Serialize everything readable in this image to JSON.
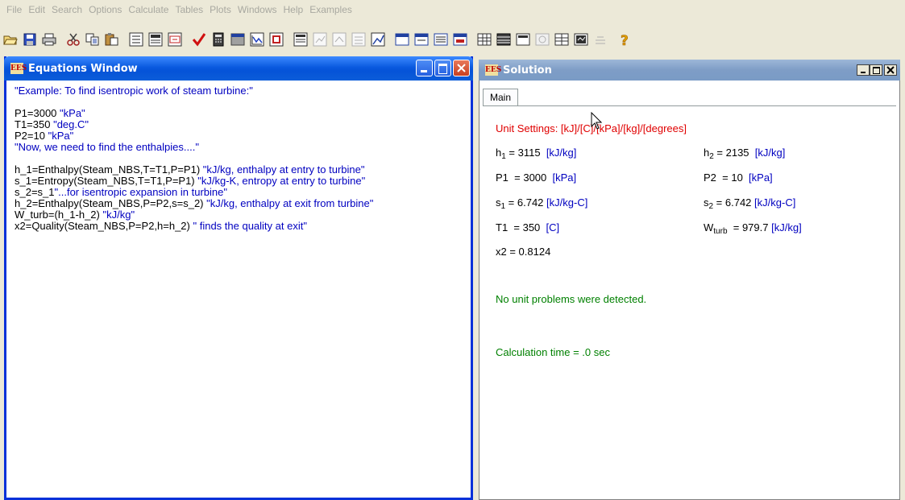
{
  "menu": [
    "File",
    "Edit",
    "Search",
    "Options",
    "Calculate",
    "Tables",
    "Plots",
    "Windows",
    "Help",
    "Examples"
  ],
  "equations_window": {
    "title": "Equations Window",
    "lines": [
      {
        "code": "",
        "comment": "\"Example: To find isentropic work of steam turbine:\""
      },
      {
        "gap": true
      },
      {
        "code": "P1=3000 ",
        "comment": "\"kPa\""
      },
      {
        "code": "T1=350 ",
        "comment": "\"deg.C\""
      },
      {
        "code": "P2=10 ",
        "comment": "\"kPa\""
      },
      {
        "code": "",
        "comment": "\"Now, we need to find the enthalpies....\""
      },
      {
        "gap": true
      },
      {
        "code": "h_1=Enthalpy(Steam_NBS,T=T1,P=P1) ",
        "comment": "\"kJ/kg, enthalpy at entry to turbine\""
      },
      {
        "code": "s_1=Entropy(Steam_NBS,T=T1,P=P1) ",
        "comment": "\"kJ/kg-K, entropy at entry to turbine\""
      },
      {
        "code": "s_2=s_1",
        "comment": "\"...for isentropic expansion in turbine\""
      },
      {
        "code": "h_2=Enthalpy(Steam_NBS,P=P2,s=s_2) ",
        "comment": "\"kJ/kg, enthalpy at exit from turbine\""
      },
      {
        "code": "W_turb=(h_1-h_2) ",
        "comment": "\"kJ/kg\""
      },
      {
        "code": "x2=Quality(Steam_NBS,P=P2,h=h_2) ",
        "comment": "\" finds the quality at exit\""
      }
    ]
  },
  "solution_window": {
    "title": "Solution",
    "tab": "Main",
    "unit_settings": "Unit Settings: [kJ]/[C]/[kPa]/[kg]/[degrees]",
    "results": {
      "h1": {
        "name": "h",
        "sub": "1",
        "value": " = 3115",
        "unit": "[kJ/kg]"
      },
      "h2": {
        "name": "h",
        "sub": "2",
        "value": " = 2135",
        "unit": "[kJ/kg]"
      },
      "P1": {
        "name": "P1",
        "value": "  = 3000",
        "unit": "[kPa]"
      },
      "P2": {
        "name": "P2",
        "value": "  = 10",
        "unit": "[kPa]"
      },
      "s1": {
        "name": "s",
        "sub": "1",
        "value": " = 6.742",
        "unit": "[kJ/kg-C]"
      },
      "s2": {
        "name": "s",
        "sub": "2",
        "value": " = 6.742",
        "unit": "[kJ/kg-C]"
      },
      "T1": {
        "name": "T1",
        "value": "  = 350",
        "unit": "[C]"
      },
      "Wturb": {
        "name": "W",
        "sub": "turb",
        "value": "  = 979.7",
        "unit": "[kJ/kg]"
      },
      "x2": {
        "name": "x2",
        "value": " = 0.8124"
      }
    },
    "unit_check": "No unit problems were detected.",
    "calc_time": "Calculation time = .0 sec"
  },
  "colors": {
    "comment": "#0000c0",
    "unit_settings": "#e00000",
    "status": "#008000",
    "active_title": "#0a5adf",
    "inactive_title": "#7e9dc6"
  },
  "toolbar_icons": [
    "open-icon",
    "save-icon",
    "print-icon",
    "cut-icon",
    "copy-icon",
    "paste-icon",
    "format-icon",
    "variable-info-icon",
    "unit-system-icon",
    "check-icon",
    "calculator-icon",
    "table-icon",
    "plot-icon",
    "solve-icon",
    "parametric-table-icon",
    "plot1-icon",
    "plot2-icon",
    "plot3-icon",
    "plot4-icon",
    "window1-icon",
    "window2-icon",
    "window3-icon",
    "window4-icon",
    "grid1-icon",
    "grid2-icon",
    "grid3-icon",
    "grid4-icon",
    "grid5-icon",
    "grid6-icon",
    "grid7-icon",
    "help-icon"
  ]
}
